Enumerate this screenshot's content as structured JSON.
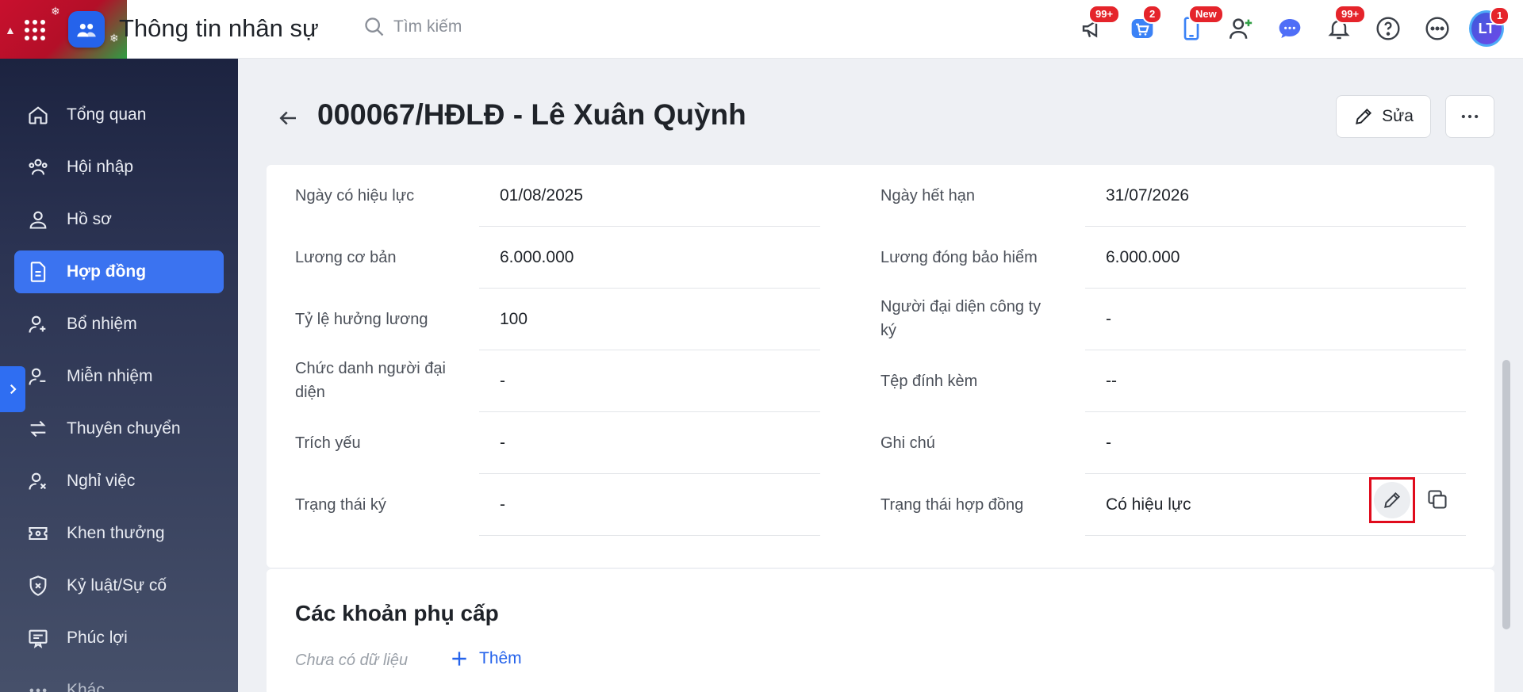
{
  "app": {
    "title": "Thông tin nhân sự"
  },
  "search": {
    "placeholder": "Tìm kiếm"
  },
  "top_icons": [
    {
      "name": "megaphone-icon",
      "badge": "99+"
    },
    {
      "name": "cart-icon",
      "badge": "2"
    },
    {
      "name": "phone-icon",
      "badge": "New"
    },
    {
      "name": "add-user-icon",
      "badge": ""
    },
    {
      "name": "chat-icon",
      "badge": ""
    },
    {
      "name": "bell-icon",
      "badge": "99+"
    },
    {
      "name": "help-icon",
      "badge": ""
    },
    {
      "name": "more-icon",
      "badge": ""
    }
  ],
  "user": {
    "initials": "LT",
    "badge": "1"
  },
  "sidebar": {
    "items": [
      {
        "label": "Tổng quan",
        "icon": "home-icon"
      },
      {
        "label": "Hội nhập",
        "icon": "group-icon"
      },
      {
        "label": "Hồ sơ",
        "icon": "person-icon"
      },
      {
        "label": "Hợp đồng",
        "icon": "document-icon",
        "active": true
      },
      {
        "label": "Bổ nhiệm",
        "icon": "person-add-icon"
      },
      {
        "label": "Miễn nhiệm",
        "icon": "person-remove-icon"
      },
      {
        "label": "Thuyên chuyển",
        "icon": "transfer-icon"
      },
      {
        "label": "Nghỉ việc",
        "icon": "person-x-icon"
      },
      {
        "label": "Khen thưởng",
        "icon": "ticket-icon"
      },
      {
        "label": "Kỷ luật/Sự cố",
        "icon": "shield-x-icon"
      },
      {
        "label": "Phúc lợi",
        "icon": "certificate-icon"
      },
      {
        "label": "Khác",
        "icon": "dots-icon"
      }
    ]
  },
  "header": {
    "title": "000067/HĐLĐ - Lê Xuân Quỳnh",
    "edit_label": "Sửa"
  },
  "fields": {
    "effective_date": {
      "label": "Ngày có hiệu lực",
      "value": "01/08/2025"
    },
    "expiry_date": {
      "label": "Ngày hết hạn",
      "value": "31/07/2026"
    },
    "base_salary": {
      "label": "Lương cơ bản",
      "value": "6.000.000"
    },
    "insurance_salary": {
      "label": "Lương đóng bảo hiểm",
      "value": "6.000.000"
    },
    "salary_ratio": {
      "label": "Tỷ lệ hưởng lương",
      "value": "100"
    },
    "company_signer": {
      "label_line1": "Người đại diện công ty",
      "label_line2": "ký",
      "value": "-"
    },
    "rep_title": {
      "label_line1": "Chức danh người đại",
      "label_line2": "diện",
      "value": "-"
    },
    "attachment": {
      "label": "Tệp đính kèm",
      "value": "--"
    },
    "summary": {
      "label": "Trích yếu",
      "value": "-"
    },
    "note": {
      "label": "Ghi chú",
      "value": "-"
    },
    "sign_status": {
      "label": "Trạng thái ký",
      "value": "-"
    },
    "contract_status": {
      "label": "Trạng thái hợp đồng",
      "value": "Có hiệu lực"
    }
  },
  "allowances": {
    "title": "Các khoản phụ cấp",
    "empty": "Chưa có dữ liệu",
    "add_label": "Thêm"
  },
  "colors": {
    "accent": "#2563eb",
    "sidebar_active": "#3b73f0",
    "highlight": "#e00b1c"
  }
}
